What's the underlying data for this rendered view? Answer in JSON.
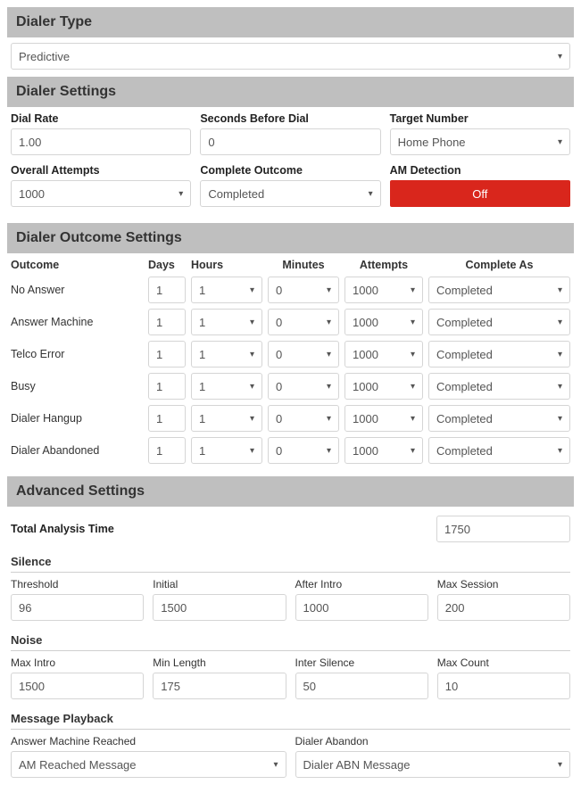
{
  "dialer_type": {
    "title": "Dialer Type",
    "value": "Predictive"
  },
  "dialer_settings": {
    "title": "Dialer Settings",
    "dial_rate": {
      "label": "Dial Rate",
      "value": "1.00"
    },
    "seconds_before_dial": {
      "label": "Seconds Before Dial",
      "value": "0"
    },
    "target_number": {
      "label": "Target Number",
      "value": "Home Phone"
    },
    "overall_attempts": {
      "label": "Overall Attempts",
      "value": "1000"
    },
    "complete_outcome": {
      "label": "Complete Outcome",
      "value": "Completed"
    },
    "am_detection": {
      "label": "AM Detection",
      "value": "Off"
    }
  },
  "outcome_settings": {
    "title": "Dialer Outcome Settings",
    "columns": {
      "outcome": "Outcome",
      "days": "Days",
      "hours": "Hours",
      "minutes": "Minutes",
      "attempts": "Attempts",
      "complete_as": "Complete As"
    },
    "rows": [
      {
        "name": "No Answer",
        "days": "1",
        "hours": "1",
        "minutes": "0",
        "attempts": "1000",
        "complete_as": "Completed"
      },
      {
        "name": "Answer Machine",
        "days": "1",
        "hours": "1",
        "minutes": "0",
        "attempts": "1000",
        "complete_as": "Completed"
      },
      {
        "name": "Telco Error",
        "days": "1",
        "hours": "1",
        "minutes": "0",
        "attempts": "1000",
        "complete_as": "Completed"
      },
      {
        "name": "Busy",
        "days": "1",
        "hours": "1",
        "minutes": "0",
        "attempts": "1000",
        "complete_as": "Completed"
      },
      {
        "name": "Dialer Hangup",
        "days": "1",
        "hours": "1",
        "minutes": "0",
        "attempts": "1000",
        "complete_as": "Completed"
      },
      {
        "name": "Dialer Abandoned",
        "days": "1",
        "hours": "1",
        "minutes": "0",
        "attempts": "1000",
        "complete_as": "Completed"
      }
    ]
  },
  "advanced": {
    "title": "Advanced Settings",
    "total_analysis": {
      "label": "Total Analysis Time",
      "value": "1750"
    },
    "silence": {
      "title": "Silence",
      "threshold": {
        "label": "Threshold",
        "value": "96"
      },
      "initial": {
        "label": "Initial",
        "value": "1500"
      },
      "after_intro": {
        "label": "After Intro",
        "value": "1000"
      },
      "max_session": {
        "label": "Max Session",
        "value": "200"
      }
    },
    "noise": {
      "title": "Noise",
      "max_intro": {
        "label": "Max Intro",
        "value": "1500"
      },
      "min_length": {
        "label": "Min Length",
        "value": "175"
      },
      "inter_silence": {
        "label": "Inter Silence",
        "value": "50"
      },
      "max_count": {
        "label": "Max Count",
        "value": "10"
      }
    },
    "playback": {
      "title": "Message Playback",
      "am_reached": {
        "label": "Answer Machine Reached",
        "value": "AM Reached Message"
      },
      "dialer_abandon": {
        "label": "Dialer Abandon",
        "value": "Dialer ABN Message"
      }
    }
  }
}
